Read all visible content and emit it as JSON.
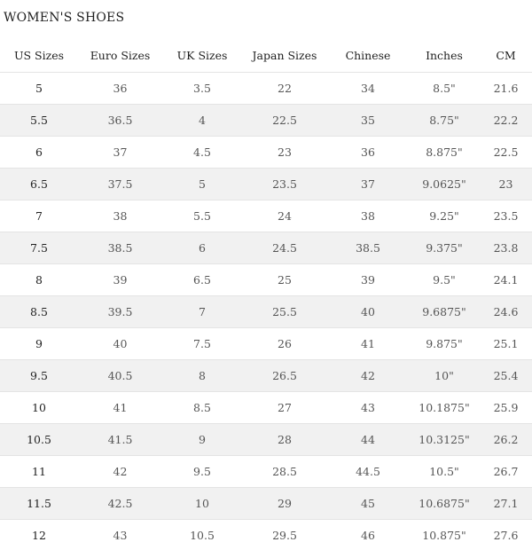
{
  "title": "WOMEN'S SHOES",
  "columns": [
    "US Sizes",
    "Euro Sizes",
    "UK Sizes",
    "Japan Sizes",
    "Chinese",
    "Inches",
    "CM"
  ],
  "rows": [
    [
      "5",
      "36",
      "3.5",
      "22",
      "34",
      "8.5\"",
      "21.6"
    ],
    [
      "5.5",
      "36.5",
      "4",
      "22.5",
      "35",
      "8.75\"",
      "22.2"
    ],
    [
      "6",
      "37",
      "4.5",
      "23",
      "36",
      "8.875\"",
      "22.5"
    ],
    [
      "6.5",
      "37.5",
      "5",
      "23.5",
      "37",
      "9.0625\"",
      "23"
    ],
    [
      "7",
      "38",
      "5.5",
      "24",
      "38",
      "9.25\"",
      "23.5"
    ],
    [
      "7.5",
      "38.5",
      "6",
      "24.5",
      "38.5",
      "9.375\"",
      "23.8"
    ],
    [
      "8",
      "39",
      "6.5",
      "25",
      "39",
      "9.5\"",
      "24.1"
    ],
    [
      "8.5",
      "39.5",
      "7",
      "25.5",
      "40",
      "9.6875\"",
      "24.6"
    ],
    [
      "9",
      "40",
      "7.5",
      "26",
      "41",
      "9.875\"",
      "25.1"
    ],
    [
      "9.5",
      "40.5",
      "8",
      "26.5",
      "42",
      "10\"",
      "25.4"
    ],
    [
      "10",
      "41",
      "8.5",
      "27",
      "43",
      "10.1875\"",
      "25.9"
    ],
    [
      "10.5",
      "41.5",
      "9",
      "28",
      "44",
      "10.3125\"",
      "26.2"
    ],
    [
      "11",
      "42",
      "9.5",
      "28.5",
      "44.5",
      "10.5\"",
      "26.7"
    ],
    [
      "11.5",
      "42.5",
      "10",
      "29",
      "45",
      "10.6875\"",
      "27.1"
    ],
    [
      "12",
      "43",
      "10.5",
      "29.5",
      "46",
      "10.875\"",
      "27.6"
    ]
  ],
  "colors": {
    "shaded_row": "#f1f1f1",
    "row_border": "#e4e4e4"
  }
}
